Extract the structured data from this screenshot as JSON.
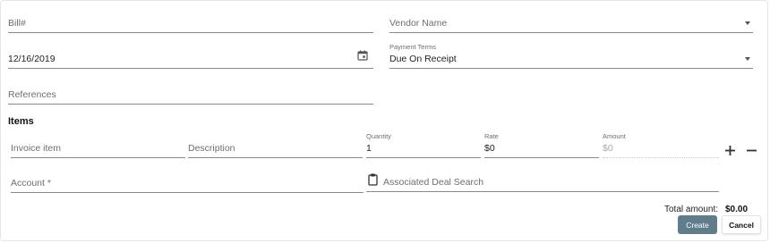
{
  "form": {
    "bill_number": {
      "placeholder": "Bill#",
      "value": ""
    },
    "vendor_name": {
      "placeholder": "Vendor Name",
      "value": ""
    },
    "bill_date": {
      "value": "12/16/2019",
      "icon": "calendar-icon"
    },
    "payment_terms": {
      "label": "Payment Terms",
      "value": "Due On Receipt"
    },
    "references": {
      "placeholder": "References",
      "value": ""
    }
  },
  "items": {
    "heading": "Items",
    "invoice_item": {
      "placeholder": "Invoice item"
    },
    "description": {
      "placeholder": "Description"
    },
    "quantity": {
      "label": "Quantity",
      "value": "1"
    },
    "rate": {
      "label": "Rate",
      "value": "$0"
    },
    "amount": {
      "label": "Amount",
      "value": "$0"
    },
    "add_icon": "plus-icon",
    "remove_icon": "minus-icon",
    "account": {
      "placeholder": "Account *"
    },
    "deal_search": {
      "placeholder": "Associated Deal Search",
      "icon": "clipboard-icon"
    }
  },
  "totals": {
    "label": "Total amount:",
    "value": "$0.00"
  },
  "actions": {
    "create": "Create",
    "cancel": "Cancel"
  },
  "colors": {
    "create_button": "#607d8b"
  }
}
